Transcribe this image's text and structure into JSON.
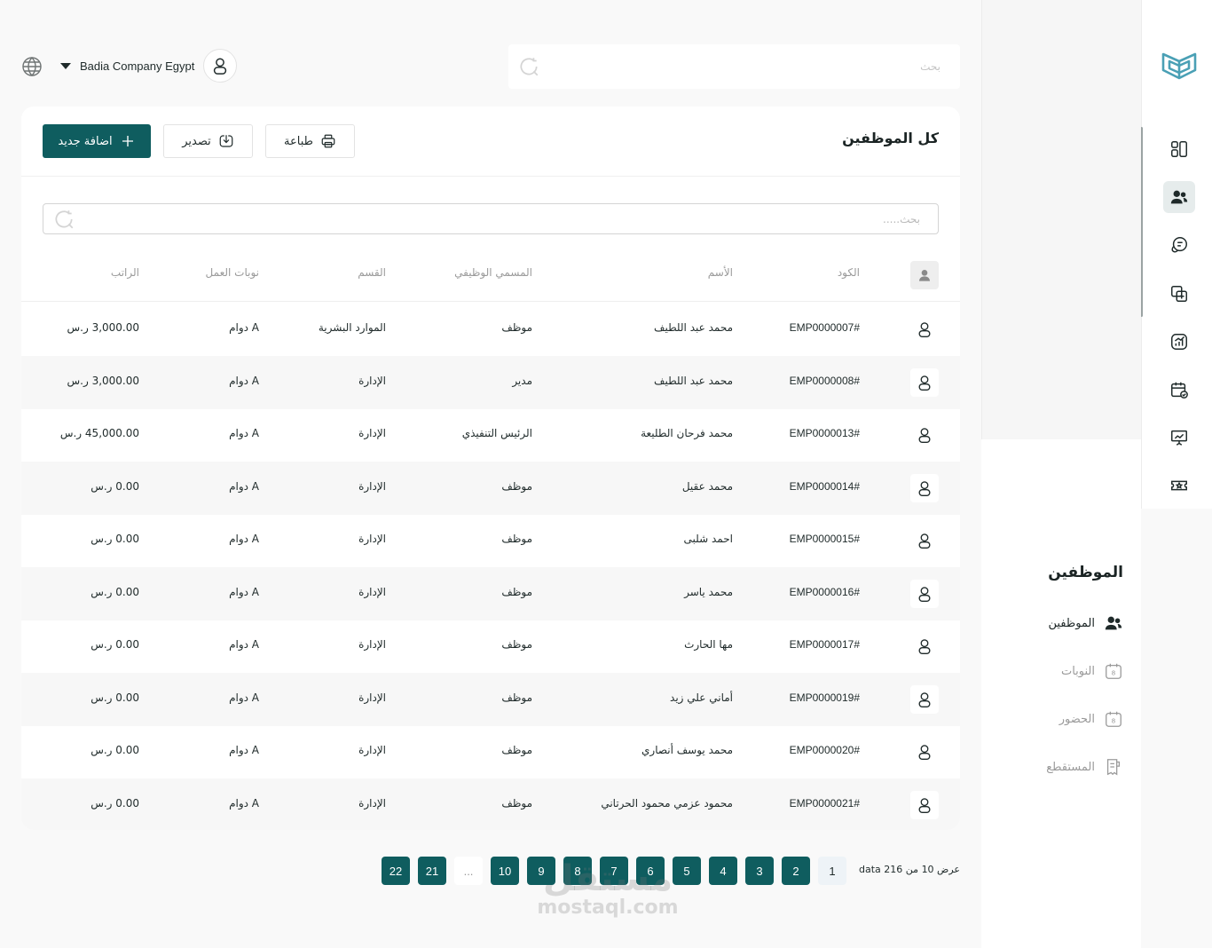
{
  "header": {
    "company_name": "Badia Company Egypt",
    "search_placeholder": "بحث"
  },
  "page": {
    "title": "كل الموظفين",
    "print_label": "طباعة",
    "export_label": "تصدير",
    "add_label": "اضافة جديد",
    "table_search_placeholder": "بحث....."
  },
  "table": {
    "columns": {
      "code": "الكود",
      "name": "الأسم",
      "job_title": "المسمي الوظيفي",
      "department": "القسم",
      "shift": "نوبات العمل",
      "salary": "الراتب"
    },
    "rows": [
      {
        "code": "EMP0000007#",
        "name": "محمد عبد اللطيف",
        "job_title": "موظف",
        "department": "الموارد البشرية",
        "shift": "دوام A",
        "salary": "3,000.00 ر.س"
      },
      {
        "code": "EMP0000008#",
        "name": "محمد عبد اللطيف",
        "job_title": "مدير",
        "department": "الإدارة",
        "shift": "دوام A",
        "salary": "3,000.00 ر.س"
      },
      {
        "code": "EMP0000013#",
        "name": "محمد فرحان الطليعة",
        "job_title": "الرئيس التنفيذي",
        "department": "الإدارة",
        "shift": "دوام A",
        "salary": "45,000.00 ر.س"
      },
      {
        "code": "EMP0000014#",
        "name": "محمد عقيل",
        "job_title": "موظف",
        "department": "الإدارة",
        "shift": "دوام A",
        "salary": "0.00 ر.س"
      },
      {
        "code": "EMP0000015#",
        "name": "احمد شلبى",
        "job_title": "موظف",
        "department": "الإدارة",
        "shift": "دوام A",
        "salary": "0.00 ر.س"
      },
      {
        "code": "EMP0000016#",
        "name": "محمد ياسر",
        "job_title": "موظف",
        "department": "الإدارة",
        "shift": "دوام A",
        "salary": "0.00 ر.س"
      },
      {
        "code": "EMP0000017#",
        "name": "مها الحارث",
        "job_title": "موظف",
        "department": "الإدارة",
        "shift": "دوام A",
        "salary": "0.00 ر.س"
      },
      {
        "code": "EMP0000019#",
        "name": "أماني علي زيد",
        "job_title": "موظف",
        "department": "الإدارة",
        "shift": "دوام A",
        "salary": "0.00 ر.س"
      },
      {
        "code": "EMP0000020#",
        "name": "محمد يوسف أنصاري",
        "job_title": "موظف",
        "department": "الإدارة",
        "shift": "دوام A",
        "salary": "0.00 ر.س"
      },
      {
        "code": "EMP0000021#",
        "name": "محمود عزمي محمود الحرتاني",
        "job_title": "موظف",
        "department": "الإدارة",
        "shift": "دوام A",
        "salary": "0.00 ر.س"
      }
    ]
  },
  "pagination": {
    "info": "عرض 10 من 216 data",
    "current": "1",
    "pages": [
      "2",
      "3",
      "4",
      "5",
      "6",
      "7",
      "8",
      "9",
      "10"
    ],
    "ellipsis": "...",
    "last_pages": [
      "21",
      "22"
    ]
  },
  "subnav": {
    "title": "الموظفين",
    "items": [
      {
        "label": "الموظفين",
        "icon": "users-icon",
        "active": true
      },
      {
        "label": "النوبات",
        "icon": "calendar-icon",
        "active": false
      },
      {
        "label": "الحضور",
        "icon": "calendar-icon",
        "active": false
      },
      {
        "label": "المستقطع",
        "icon": "receipt-icon",
        "active": false
      }
    ]
  },
  "rail": {
    "icons": [
      "dashboard-icon",
      "users-icon",
      "chat-icon",
      "copy-add-icon",
      "chart-icon",
      "calendar-check-icon",
      "presentation-icon",
      "ticket-star-icon"
    ]
  },
  "watermark": {
    "arabic": "مستقل",
    "latin": "mostaql.com"
  },
  "colors": {
    "primary": "#0f5d5f",
    "background": "#f9f9f9",
    "row_alt": "#f7f7f7"
  }
}
